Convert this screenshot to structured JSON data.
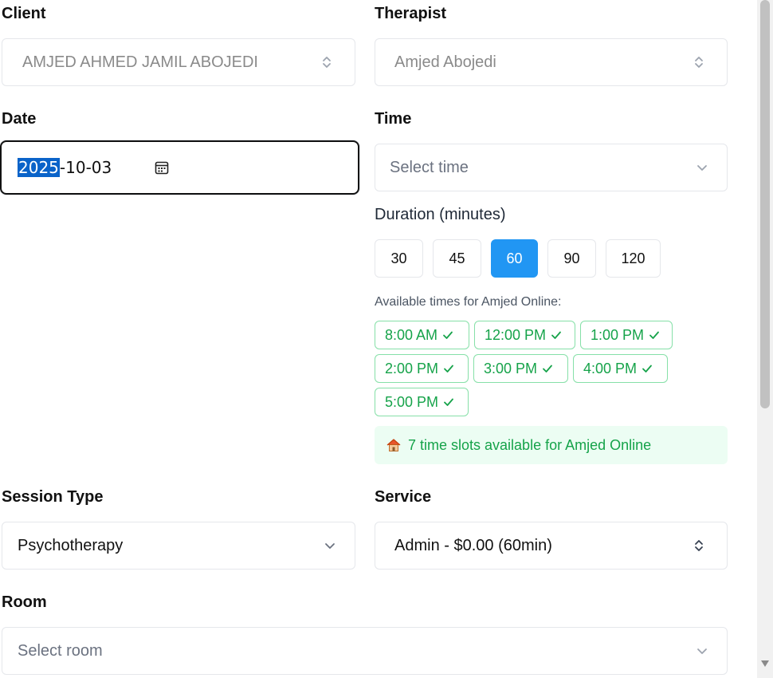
{
  "client": {
    "label": "Client",
    "value": "AMJED AHMED JAMIL ABOJEDI"
  },
  "therapist": {
    "label": "Therapist",
    "value": "Amjed Abojedi"
  },
  "date": {
    "label": "Date",
    "year": "2025",
    "rest": "-10-03"
  },
  "time": {
    "label": "Time",
    "placeholder": "Select time"
  },
  "duration": {
    "label": "Duration (minutes)",
    "options": [
      "30",
      "45",
      "60",
      "90",
      "120"
    ],
    "selected": "60"
  },
  "availability": {
    "title": "Available times for Amjed Online:",
    "slots": [
      "8:00 AM",
      "12:00 PM",
      "1:00 PM",
      "2:00 PM",
      "3:00 PM",
      "4:00 PM",
      "5:00 PM"
    ],
    "notice": "7 time slots available for Amjed Online"
  },
  "session_type": {
    "label": "Session Type",
    "value": "Psychotherapy"
  },
  "service": {
    "label": "Service",
    "value": "Admin - $0.00 (60min)"
  },
  "room": {
    "label": "Room",
    "placeholder": "Select room"
  },
  "colors": {
    "accent": "#2196f3",
    "success": "#16a34a",
    "selection": "#0a63c9"
  }
}
